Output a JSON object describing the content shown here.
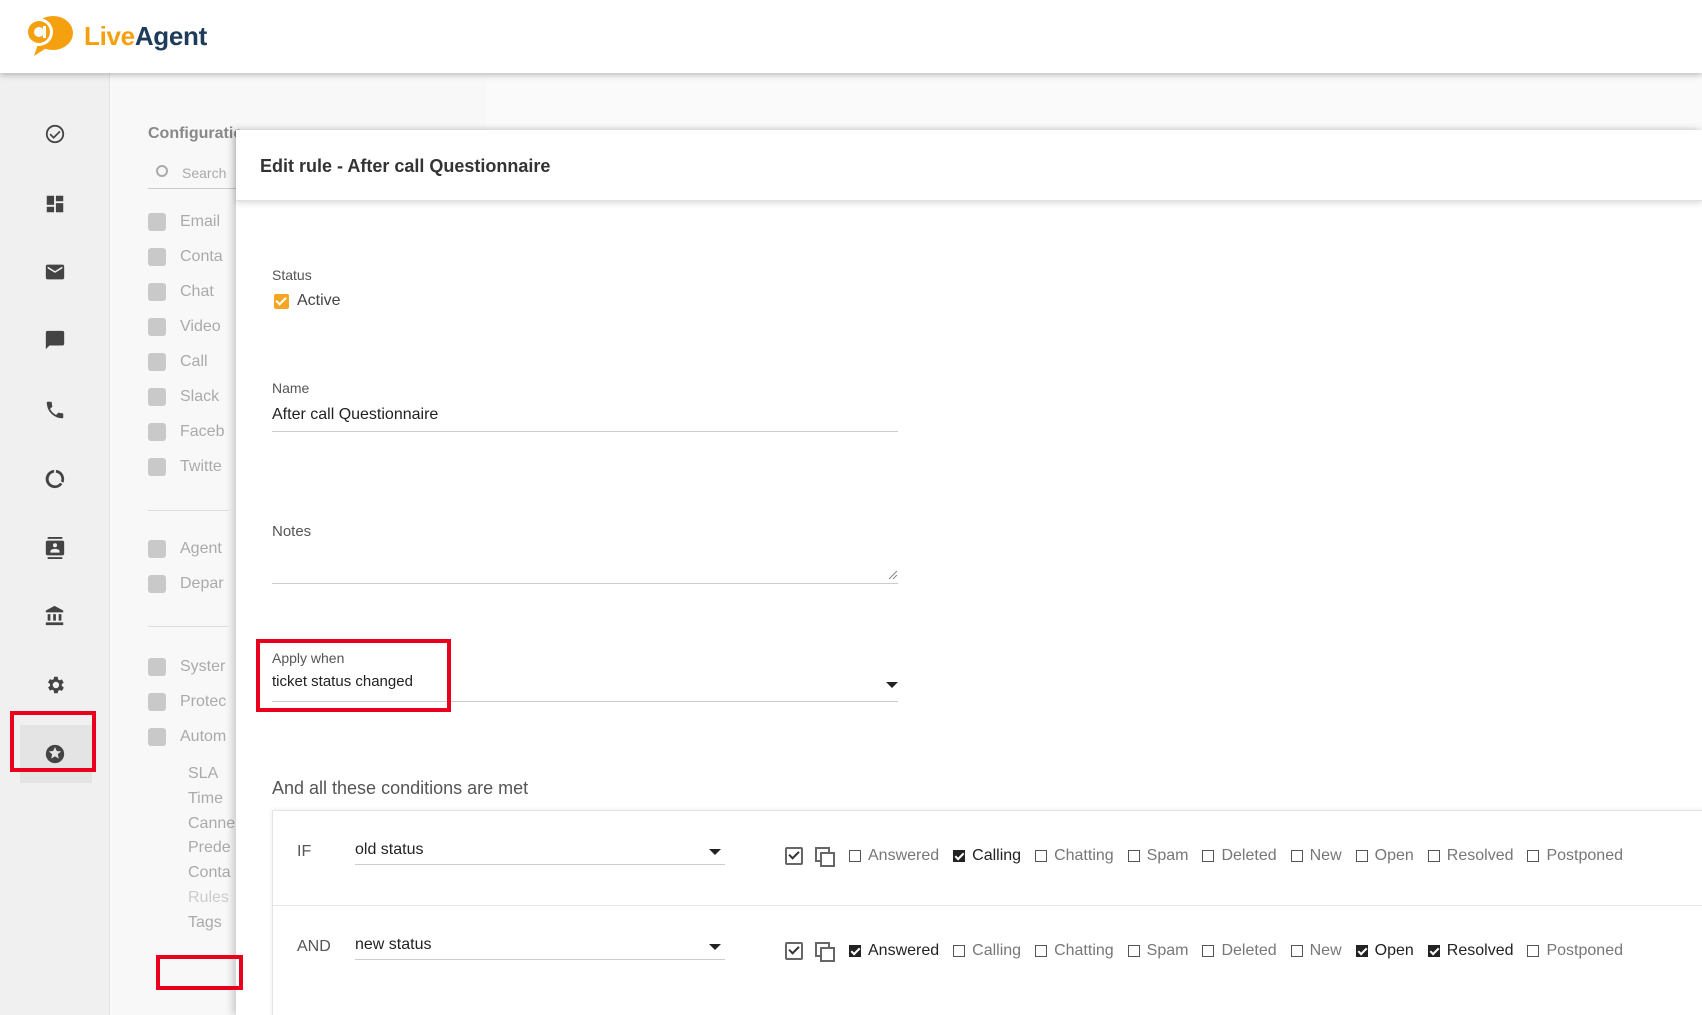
{
  "app": {
    "logo_live": "Live",
    "logo_agent": "Agent",
    "brand_color": "#f5a00f"
  },
  "rail": {
    "icons": [
      "check-circle-icon",
      "dashboard-icon",
      "mail-icon",
      "chat-icon",
      "phone-icon",
      "reports-icon",
      "contacts-icon",
      "knowledgebase-icon",
      "gear-icon",
      "star-icon"
    ],
    "active": "gear-icon"
  },
  "config": {
    "title": "Configuratio",
    "search_placeholder": "Search",
    "items": [
      {
        "label": "Email",
        "icon": "at-icon"
      },
      {
        "label": "Conta",
        "icon": "contact-form-icon"
      },
      {
        "label": "Chat",
        "icon": "chat-icon"
      },
      {
        "label": "Video",
        "icon": "video-icon"
      },
      {
        "label": "Call",
        "icon": "phone-icon"
      },
      {
        "label": "Slack",
        "icon": "slack-icon"
      },
      {
        "label": "Faceb",
        "icon": "facebook-icon"
      },
      {
        "label": "Twitte",
        "icon": "twitter-icon"
      }
    ],
    "items2": [
      {
        "label": "Agent",
        "icon": "agents-icon"
      },
      {
        "label": "Depar",
        "icon": "folder-icon"
      }
    ],
    "items3": [
      {
        "label": "Syster",
        "icon": "gear-icon"
      },
      {
        "label": "Protec",
        "icon": "shield-icon"
      },
      {
        "label": "Autom",
        "icon": "refresh-icon"
      }
    ],
    "subitems": [
      "SLA",
      "Time",
      "Canne",
      "Prede",
      "Conta",
      "Rules",
      "Tags"
    ]
  },
  "editor": {
    "title": "Edit rule - After call Questionnaire",
    "status_label": "Status",
    "status_value": "Active",
    "name_label": "Name",
    "name_value": "After call Questionnaire",
    "notes_label": "Notes",
    "apply_label": "Apply when",
    "apply_value": "ticket status changed",
    "conditions_title": "And all these conditions are met",
    "conditions": [
      {
        "op": "IF",
        "field": "old status",
        "options": [
          {
            "label": "Answered",
            "checked": false
          },
          {
            "label": "Calling",
            "checked": true
          },
          {
            "label": "Chatting",
            "checked": false
          },
          {
            "label": "Spam",
            "checked": false
          },
          {
            "label": "Deleted",
            "checked": false
          },
          {
            "label": "New",
            "checked": false
          },
          {
            "label": "Open",
            "checked": false
          },
          {
            "label": "Resolved",
            "checked": false
          },
          {
            "label": "Postponed",
            "checked": false
          }
        ]
      },
      {
        "op": "AND",
        "field": "new status",
        "options": [
          {
            "label": "Answered",
            "checked": true
          },
          {
            "label": "Calling",
            "checked": false
          },
          {
            "label": "Chatting",
            "checked": false
          },
          {
            "label": "Spam",
            "checked": false
          },
          {
            "label": "Deleted",
            "checked": false
          },
          {
            "label": "New",
            "checked": false
          },
          {
            "label": "Open",
            "checked": true
          },
          {
            "label": "Resolved",
            "checked": true
          },
          {
            "label": "Postponed",
            "checked": false
          }
        ]
      }
    ]
  },
  "highlight_color": "#e8001c"
}
